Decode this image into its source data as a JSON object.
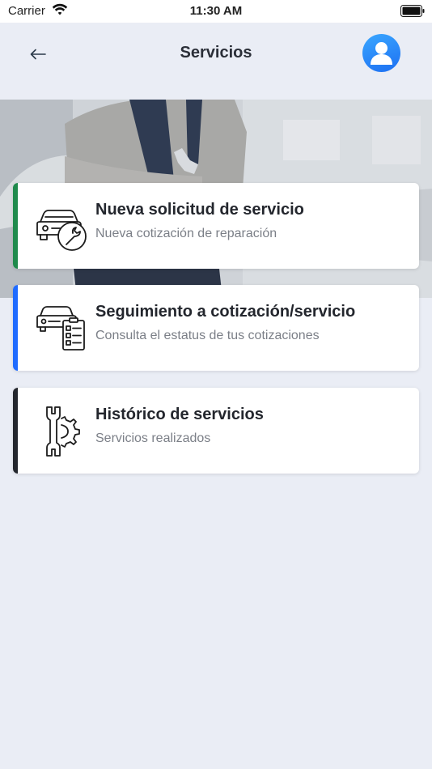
{
  "status_bar": {
    "carrier": "Carrier",
    "time": "11:30 AM"
  },
  "header": {
    "title": "Servicios"
  },
  "icons": {
    "back": "arrow-left-icon",
    "avatar": "user-icon",
    "card1": "car-wrench-icon",
    "card2": "car-checklist-icon",
    "card3": "gear-wrench-icon"
  },
  "colors": {
    "background": "#eaedf5",
    "accent_green": "#1f8a4c",
    "accent_blue": "#1f6bff",
    "accent_dark": "#23262d",
    "avatar_blue": "#1d6ff2"
  },
  "cards": [
    {
      "title": "Nueva solicitud de servicio",
      "subtitle": "Nueva cotización de reparación"
    },
    {
      "title": "Seguimiento a cotización/servicio",
      "subtitle": "Consulta el estatus de tus cotizaciones"
    },
    {
      "title": "Histórico de servicios",
      "subtitle": "Servicios realizados"
    }
  ]
}
